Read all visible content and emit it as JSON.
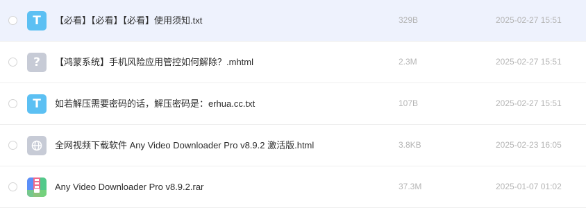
{
  "files": [
    {
      "name": "【必看】【必看】【必看】使用须知.txt",
      "size": "329B",
      "date": "2025-02-27 15:51",
      "icon": "txt-file-icon",
      "icon_glyph": "T"
    },
    {
      "name": "【鸿蒙系统】手机风险应用管控如何解除？.mhtml",
      "size": "2.3M",
      "date": "2025-02-27 15:51",
      "icon": "unknown-file-icon",
      "icon_glyph": "?"
    },
    {
      "name": "如若解压需要密码的话，解压密码是：erhua.cc.txt",
      "size": "107B",
      "date": "2025-02-27 15:51",
      "icon": "txt-file-icon",
      "icon_glyph": "T"
    },
    {
      "name": "全网视频下载软件 Any Video Downloader Pro v8.9.2 激活版.html",
      "size": "3.8KB",
      "date": "2025-02-23 16:05",
      "icon": "html-globe-icon"
    },
    {
      "name": "Any Video Downloader Pro v8.9.2.rar",
      "size": "37.3M",
      "date": "2025-01-07 01:02",
      "icon": "rar-archive-icon"
    }
  ],
  "colors": {
    "hover_row": "#eef2fd",
    "txt_icon": "#5cc0f3",
    "unknown_icon": "#c7cbd6",
    "name_text": "#2c2c2c",
    "meta_text": "#b5b5b5"
  }
}
